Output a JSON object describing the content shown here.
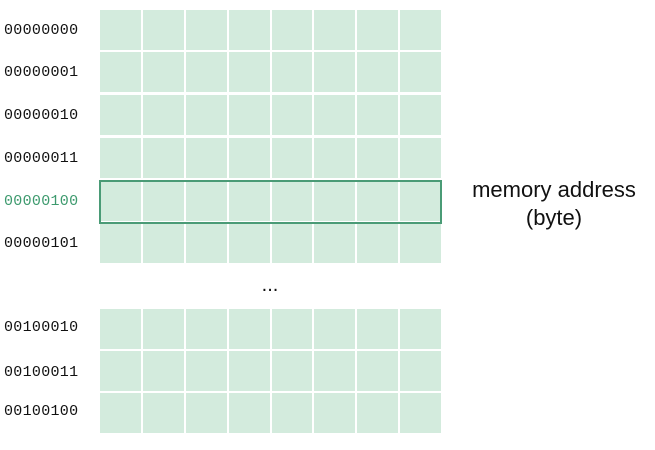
{
  "addresses_top": [
    "00000000",
    "00000001",
    "00000010",
    "00000011",
    "00000100",
    "00000101"
  ],
  "highlighted_address": "00000100",
  "ellipsis": "...",
  "addresses_bottom": [
    "00100010",
    "00100011",
    "00100100"
  ],
  "label": {
    "line1": "memory address",
    "line2": "(byte)"
  },
  "bits_per_row": 8,
  "colors": {
    "cell_fill": "#d3ebdd",
    "highlight": "#4a9b76",
    "highlight_text": "#3d9a6e"
  }
}
